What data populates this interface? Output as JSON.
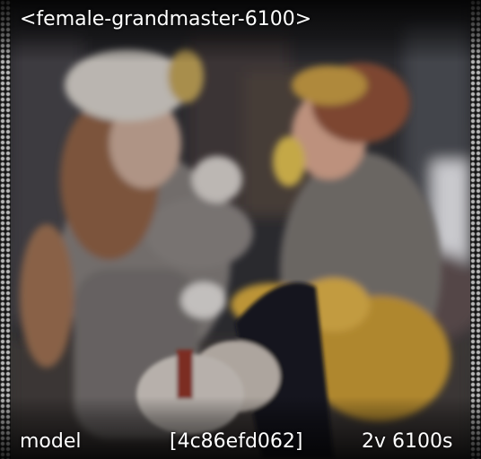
{
  "title": "<female-grandmaster-6100>",
  "footer": {
    "label": "model",
    "hash": "[4c86efd062]",
    "stats": "2v 6100s"
  },
  "colors": {
    "border_bead": "#b9b9b9",
    "text": "#ffffff",
    "background": "#0b0b0c"
  }
}
